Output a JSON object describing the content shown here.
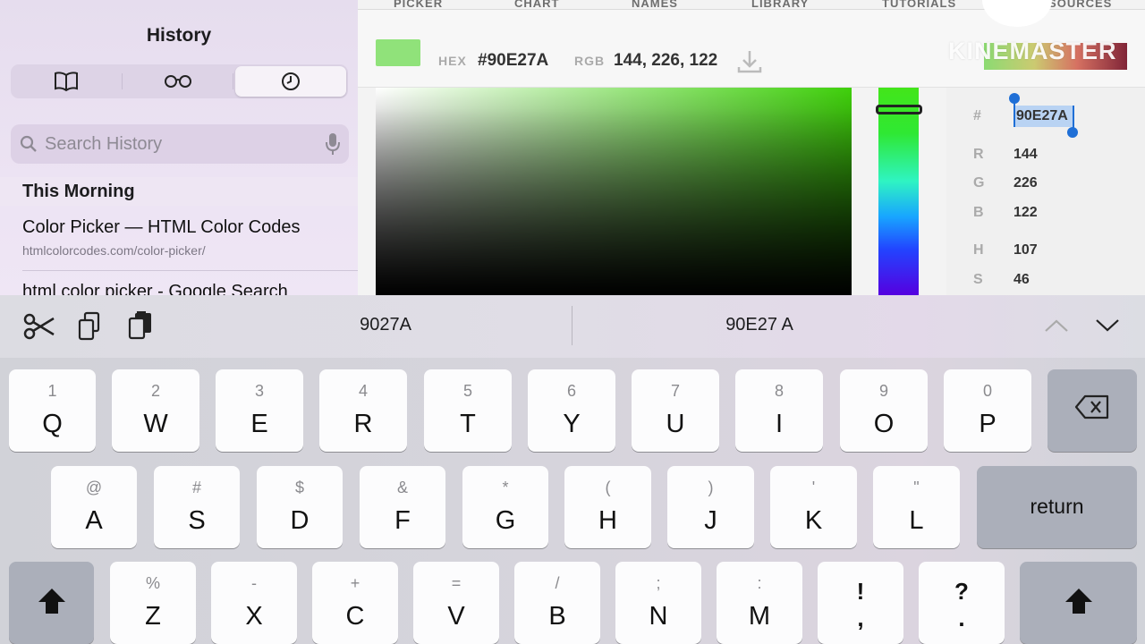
{
  "sidebar": {
    "title": "History",
    "search_placeholder": "Search History",
    "section_header": "This Morning",
    "items": [
      {
        "title": "Color Picker — HTML Color Codes",
        "url": "htmlcolorcodes.com/color-picker/"
      },
      {
        "title": "html color picker - Google Search"
      }
    ]
  },
  "web": {
    "nav": [
      "PICKER",
      "CHART",
      "NAMES",
      "LIBRARY",
      "TUTORIALS",
      "RESOURCES"
    ],
    "hex_label": "HEX",
    "hex_value": "#90E27A",
    "rgb_label": "RGB",
    "rgb_value": "144, 226, 122",
    "selected_color": "#90E27A",
    "panel": {
      "hash_label": "#",
      "hex_input": "90E27A",
      "rows": [
        {
          "label": "R",
          "value": "144"
        },
        {
          "label": "G",
          "value": "226"
        },
        {
          "label": "B",
          "value": "122"
        },
        {
          "label": "H",
          "value": "107"
        },
        {
          "label": "S",
          "value": "46"
        }
      ]
    }
  },
  "watermark": "KINEMASTER",
  "shortcut_bar": {
    "suggestion_1": "9027A",
    "suggestion_2": "90E27 A"
  },
  "keyboard": {
    "row1": [
      {
        "main": "Q",
        "sub": "1"
      },
      {
        "main": "W",
        "sub": "2"
      },
      {
        "main": "E",
        "sub": "3"
      },
      {
        "main": "R",
        "sub": "4"
      },
      {
        "main": "T",
        "sub": "5"
      },
      {
        "main": "Y",
        "sub": "6"
      },
      {
        "main": "U",
        "sub": "7"
      },
      {
        "main": "I",
        "sub": "8"
      },
      {
        "main": "O",
        "sub": "9"
      },
      {
        "main": "P",
        "sub": "0"
      }
    ],
    "row2": [
      {
        "main": "A",
        "sub": "@"
      },
      {
        "main": "S",
        "sub": "#"
      },
      {
        "main": "D",
        "sub": "$"
      },
      {
        "main": "F",
        "sub": "&"
      },
      {
        "main": "G",
        "sub": "*"
      },
      {
        "main": "H",
        "sub": "("
      },
      {
        "main": "J",
        "sub": ")"
      },
      {
        "main": "K",
        "sub": "'"
      },
      {
        "main": "L",
        "sub": "\""
      }
    ],
    "return_label": "return",
    "row3": [
      {
        "main": "Z",
        "sub": "%"
      },
      {
        "main": "X",
        "sub": "-"
      },
      {
        "main": "C",
        "sub": "+"
      },
      {
        "main": "V",
        "sub": "="
      },
      {
        "main": "B",
        "sub": "/"
      },
      {
        "main": "N",
        "sub": ";"
      },
      {
        "main": "M",
        "sub": ":"
      }
    ],
    "punct": [
      {
        "top": "!",
        "bottom": ","
      },
      {
        "top": "?",
        "bottom": "."
      }
    ]
  }
}
